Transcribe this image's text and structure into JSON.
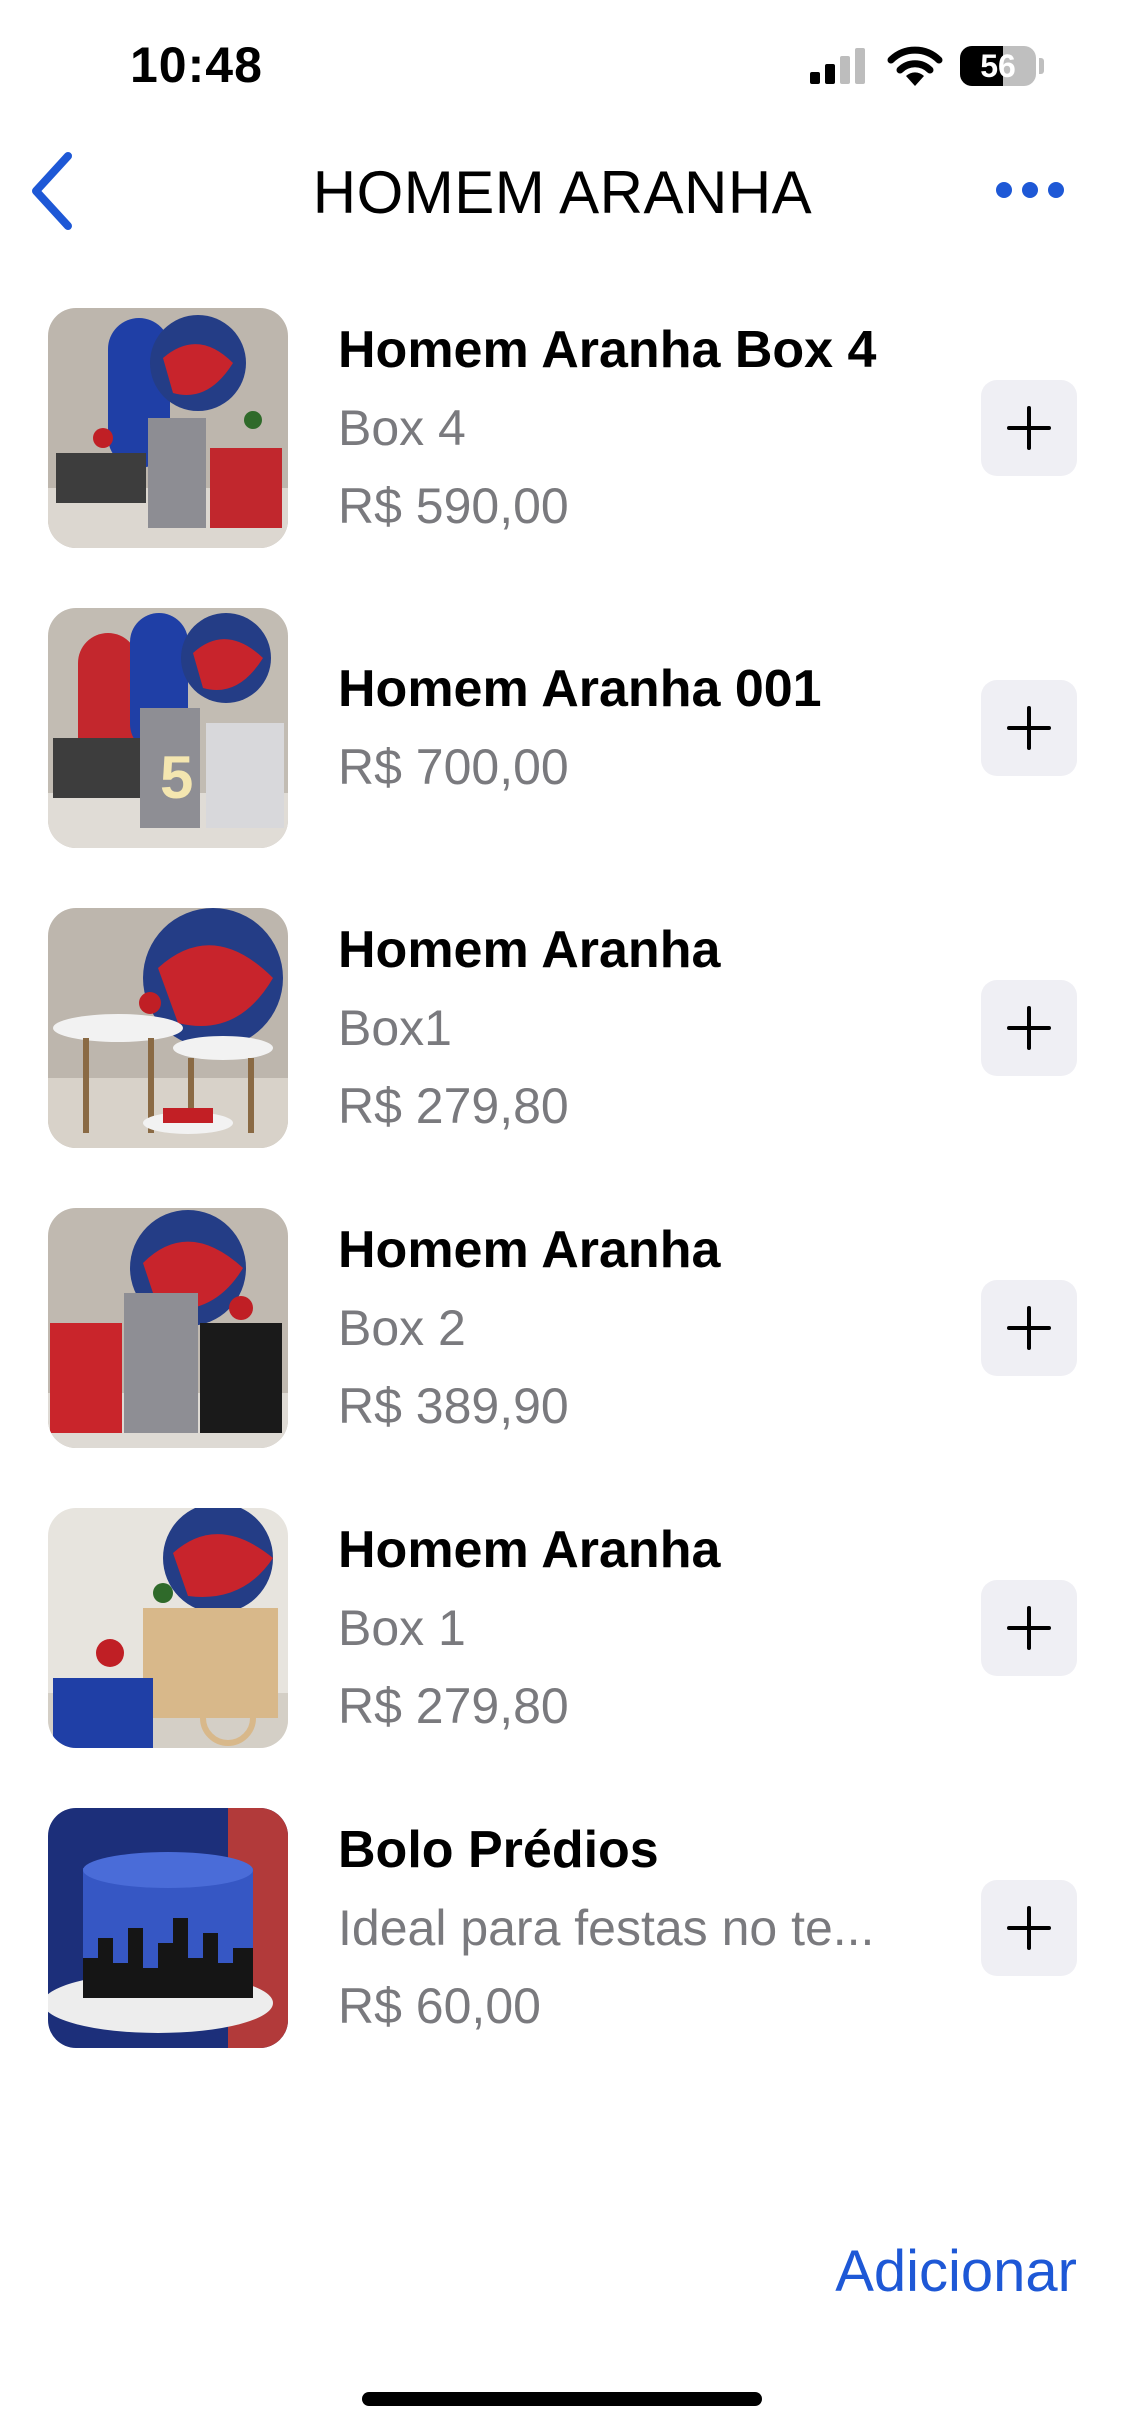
{
  "status_bar": {
    "time": "10:48",
    "battery": "56",
    "battery_level": 0.56
  },
  "nav": {
    "title": "HOMEM ARANHA",
    "accent_color": "#1e58d6",
    "back_icon": "chevron-left-icon",
    "more_icon": "ellipsis-icon"
  },
  "items": [
    {
      "title": "Homem Aranha Box 4",
      "subtitle": "Box 4",
      "price": "R$ 590,00"
    },
    {
      "title": "Homem Aranha 001",
      "subtitle": "",
      "price": "R$ 700,00"
    },
    {
      "title": "Homem Aranha",
      "subtitle": "Box1",
      "price": "R$ 279,80"
    },
    {
      "title": "Homem Aranha",
      "subtitle": "Box 2",
      "price": "R$ 389,90"
    },
    {
      "title": "Homem Aranha",
      "subtitle": "Box 1",
      "price": "R$ 279,80"
    },
    {
      "title": "Bolo Prédios",
      "subtitle": "Ideal para festas no te...",
      "price": "R$ 60,00"
    }
  ],
  "footer": {
    "add_label": "Adicionar"
  }
}
